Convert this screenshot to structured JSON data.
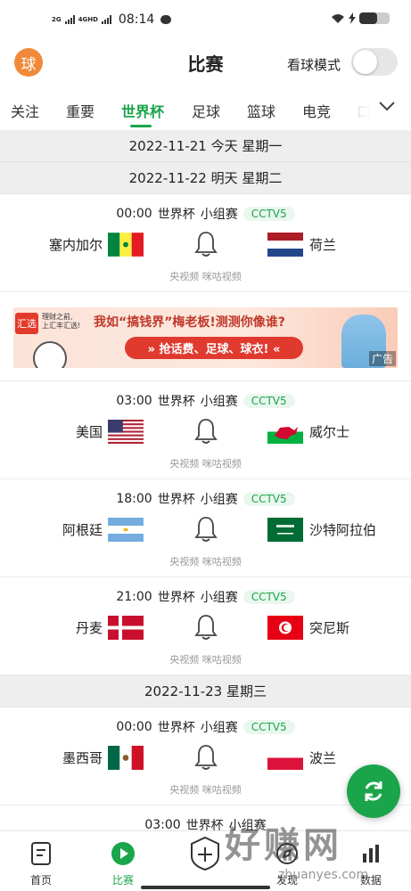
{
  "status_bar": {
    "network_1": "2G",
    "network_2": "4GHD",
    "time": "08:14"
  },
  "header": {
    "logo_text": "球",
    "title": "比赛",
    "mode_label": "看球模式",
    "mode_on": false
  },
  "tabs": [
    {
      "label": "关注",
      "active": false
    },
    {
      "label": "重要",
      "active": false
    },
    {
      "label": "世界杯",
      "active": true
    },
    {
      "label": "足球",
      "active": false
    },
    {
      "label": "篮球",
      "active": false
    },
    {
      "label": "电竞",
      "active": false
    },
    {
      "label": "口",
      "active": false
    }
  ],
  "dates": {
    "d1": "2022-11-21 今天 星期一",
    "d2": "2022-11-22 明天 星期二",
    "d3": "2022-11-23 星期三"
  },
  "matches": [
    {
      "time": "00:00",
      "league": "世界杯",
      "stage": "小组赛",
      "channel": "CCTV5",
      "home": "塞内加尔",
      "away": "荷兰",
      "sources": "央视频 咪咕视频"
    },
    {
      "time": "03:00",
      "league": "世界杯",
      "stage": "小组赛",
      "channel": "CCTV5",
      "home": "美国",
      "away": "威尔士",
      "sources": "央视频 咪咕视频"
    },
    {
      "time": "18:00",
      "league": "世界杯",
      "stage": "小组赛",
      "channel": "CCTV5",
      "home": "阿根廷",
      "away": "沙特阿拉伯",
      "sources": "央视频 咪咕视频"
    },
    {
      "time": "21:00",
      "league": "世界杯",
      "stage": "小组赛",
      "channel": "CCTV5",
      "home": "丹麦",
      "away": "突尼斯",
      "sources": "央视频 咪咕视频"
    },
    {
      "time": "00:00",
      "league": "世界杯",
      "stage": "小组赛",
      "channel": "CCTV5",
      "home": "墨西哥",
      "away": "波兰",
      "sources": "央视频 咪咕视频"
    },
    {
      "time": "03:00",
      "league": "世界杯",
      "stage": "小组赛",
      "channel": "",
      "home": "",
      "away": "",
      "sources": ""
    }
  ],
  "ad": {
    "brand": "汇选",
    "brand_line1": "理财之前,",
    "brand_line2": "上汇丰汇选!",
    "headline": "我如“搞钱界”梅老板!测测你像谁?",
    "button": "» 抢话费、足球、球衣! «",
    "tag": "广告"
  },
  "bottom_nav": [
    {
      "label": "首页",
      "active": false
    },
    {
      "label": "比赛",
      "active": true
    },
    {
      "label": "",
      "active": false
    },
    {
      "label": "发现",
      "active": false
    },
    {
      "label": "数据",
      "active": false
    }
  ],
  "watermark": {
    "text": "好赚网",
    "sub": "zhuanyes.com"
  },
  "colors": {
    "accent": "#1aa54b",
    "logo": "#f08a3a",
    "ad_red": "#e03a2f"
  }
}
